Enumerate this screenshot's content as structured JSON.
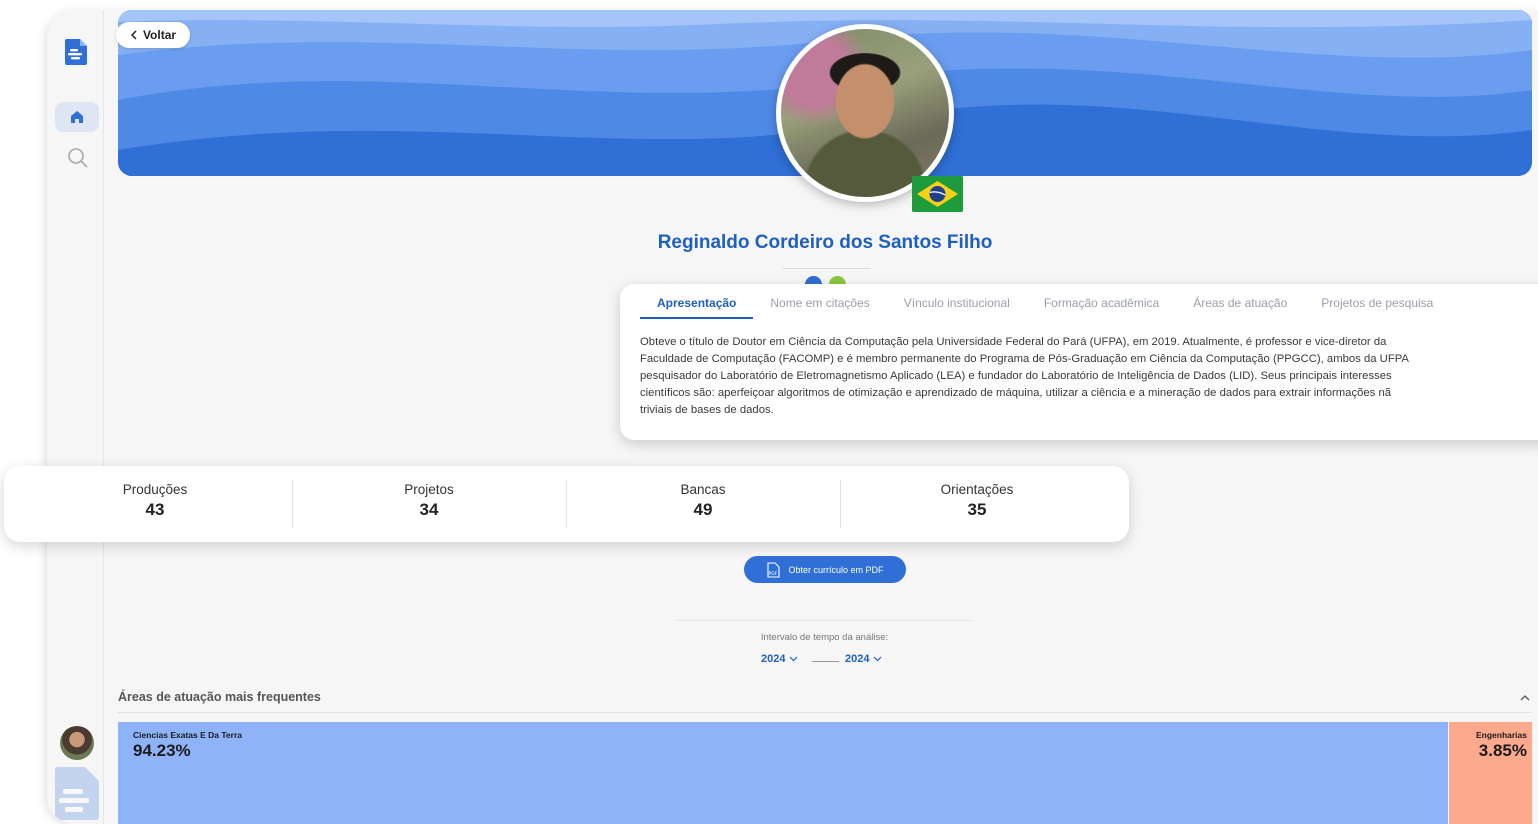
{
  "header": {
    "back_label": "Voltar"
  },
  "profile": {
    "name": "Reginaldo Cordeiro dos Santos Filho",
    "country_flag": "Brazil"
  },
  "tabs": [
    {
      "label": "Apresentação",
      "active": true
    },
    {
      "label": "Nome em citações",
      "active": false
    },
    {
      "label": "Vínculo institucional",
      "active": false
    },
    {
      "label": "Formação acadêmica",
      "active": false
    },
    {
      "label": "Áreas de atuação",
      "active": false
    },
    {
      "label": "Projetos de pesquisa",
      "active": false
    }
  ],
  "presentation_lines": [
    "Obteve o título de Doutor em Ciência da Computação pela Universidade Federal do Pará (UFPA), em 2019. Atualmente, é professor e vice-diretor da",
    "Faculdade de Computação (FACOMP) e é membro permanente do Programa de Pós-Graduação em Ciência da Computação (PPGCC), ambos da UFPA",
    "pesquisador do Laboratório de Eletromagnetismo Aplicado (LEA) e fundador do Laboratório de Inteligência de Dados (LID). Seus principais interesses",
    "científicos são: aperfeiçoar algoritmos de otimização e aprendizado de máquina, utilizar a ciência e a mineração de dados para extrair informações nã",
    "triviais de bases de dados."
  ],
  "stats": [
    {
      "label": "Produções",
      "value": "43"
    },
    {
      "label": "Projetos",
      "value": "34"
    },
    {
      "label": "Bancas",
      "value": "49"
    },
    {
      "label": "Orientações",
      "value": "35"
    }
  ],
  "pdf_button": {
    "label": "Obter currículo em PDF",
    "icon_text": "PDF"
  },
  "time_range": {
    "label": "Intervalo de tempo da análise:",
    "from": "2024",
    "to": "2024"
  },
  "areas_section": {
    "title": "Áreas de atuação mais frequentes",
    "items": [
      {
        "name": "Ciencias Exatas E Da Terra",
        "percent_label": "94.23%",
        "share": 94.23,
        "color": "#8fb3f9"
      },
      {
        "name": "Engenharias",
        "percent_label": "3.85%",
        "share": 3.85,
        "color": "#fda98d"
      }
    ]
  },
  "colors": {
    "accent": "#1f5fbf",
    "button": "#2f6fd6",
    "banner": "#2f6fd6"
  },
  "icons": [
    "document-logo-icon",
    "home-icon",
    "search-icon",
    "chevron-left-icon",
    "chevron-down-icon",
    "chevron-up-icon",
    "pdf-icon",
    "brazil-flag-icon"
  ]
}
